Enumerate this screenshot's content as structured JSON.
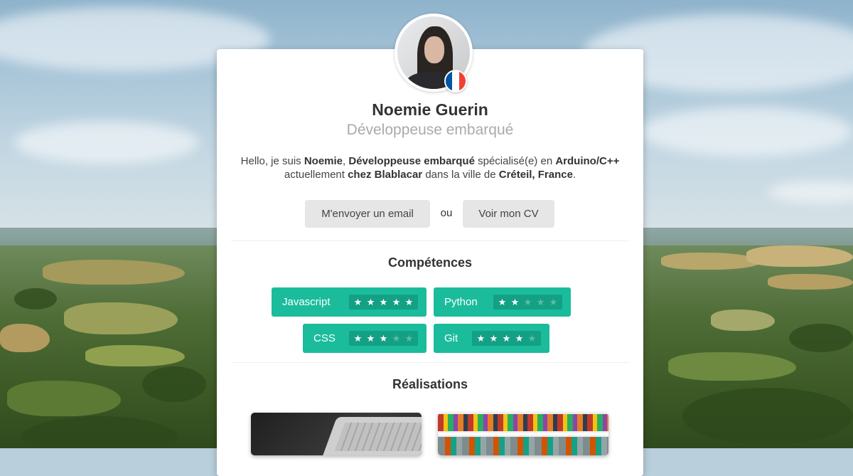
{
  "profile": {
    "name": "Noemie Guerin",
    "role": "Développeuse embarqué",
    "avatar_icon": "profile-photo",
    "flag_icon": "france-flag-icon",
    "flag_colors": [
      "#0055a4",
      "#ffffff",
      "#ef4135"
    ]
  },
  "bio": {
    "p1": "Hello, je suis ",
    "name": "Noemie",
    "p2": ", ",
    "role": "Développeuse embarqué",
    "p3": " spécialisé(e) en ",
    "skill": "Arduino/C++",
    "p4": " actuellement ",
    "company": "chez Blablacar",
    "p5": " dans la ville de ",
    "city": "Créteil, France",
    "p6": "."
  },
  "actions": {
    "email_label": "M'envoyer un email",
    "or_label": "ou",
    "cv_label": "Voir mon CV"
  },
  "skills_section": {
    "title": "Compétences",
    "items": [
      {
        "label": "Javascript",
        "rating": 5,
        "max": 5
      },
      {
        "label": "Python",
        "rating": 2,
        "max": 5
      },
      {
        "label": "CSS",
        "rating": 3,
        "max": 5
      },
      {
        "label": "Git",
        "rating": 4,
        "max": 5
      }
    ],
    "star_glyph": "★",
    "accent": "#1abc9c"
  },
  "projects_section": {
    "title": "Réalisations",
    "items": [
      {
        "image": "laptop-keyboard-photo"
      },
      {
        "image": "store-shelf-bottles-photo"
      }
    ]
  }
}
